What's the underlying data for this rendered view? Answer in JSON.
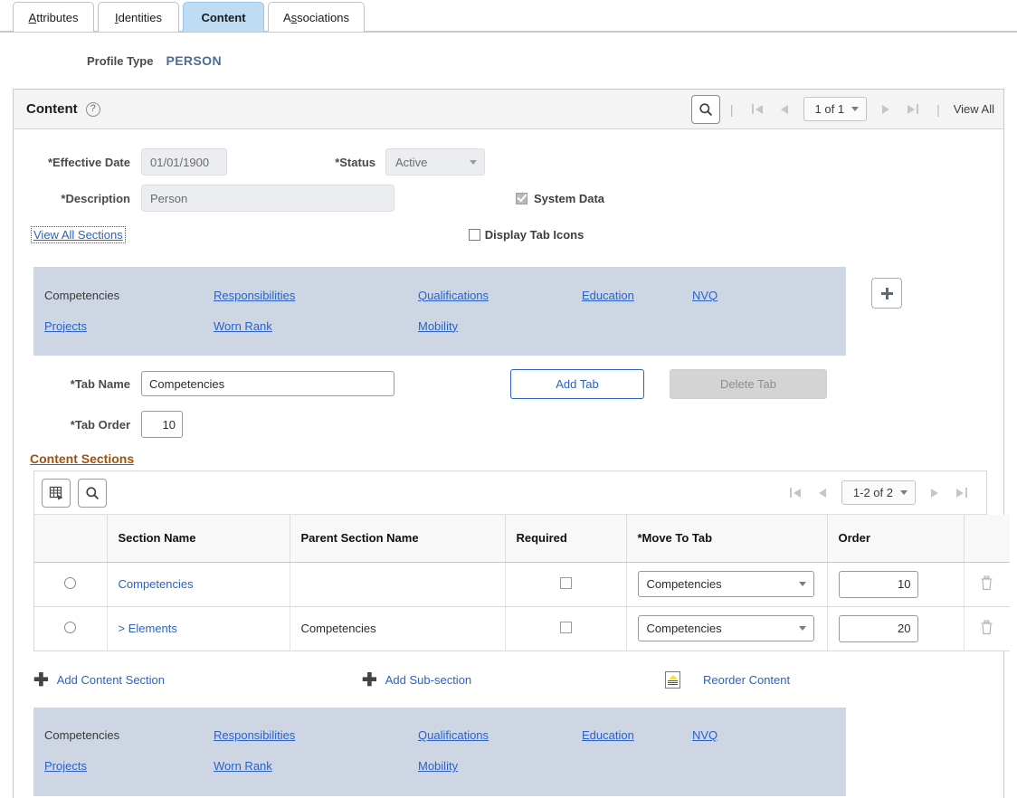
{
  "tabs": [
    {
      "label": "Attributes",
      "accesskey_index": 0,
      "active": false
    },
    {
      "label": "Identities",
      "accesskey_index": 0,
      "active": false
    },
    {
      "label": "Content",
      "accesskey_index": -1,
      "active": true
    },
    {
      "label": "Associations",
      "accesskey_index": 1,
      "active": false
    }
  ],
  "profile": {
    "label": "Profile Type",
    "value": "PERSON"
  },
  "panel": {
    "title": "Content",
    "help_icon": "question-mark-icon",
    "search_icon": "magnifier-icon",
    "pager": {
      "first_icon": "first-page-icon",
      "prev_icon": "previous-page-icon",
      "value": "1 of 1",
      "next_icon": "next-page-icon",
      "last_icon": "last-page-icon"
    },
    "view_all": "View All",
    "add_row_icon": "plus-icon"
  },
  "form": {
    "effective_date_label": "*Effective Date",
    "effective_date_value": "01/01/1900",
    "description_label": "*Description",
    "description_value": "Person",
    "view_all_sections": "View All Sections",
    "status_label": "*Status",
    "status_value": "Active",
    "system_data_label": "System Data",
    "system_data_checked": true,
    "display_tab_icons_label": "Display Tab Icons",
    "display_tab_icons_checked": false
  },
  "tab_links_panel": {
    "row1": [
      {
        "label": "Competencies",
        "is_link": false
      },
      {
        "label": "Responsibilities",
        "is_link": true
      },
      {
        "label": "Qualifications",
        "is_link": true
      },
      {
        "label": "Education",
        "is_link": true
      },
      {
        "label": "NVQ",
        "is_link": true
      }
    ],
    "row2": [
      {
        "label": "Projects",
        "is_link": true
      },
      {
        "label": "Worn Rank",
        "is_link": true
      },
      {
        "label": "Mobility",
        "is_link": true
      }
    ]
  },
  "tab_edit": {
    "tab_name_label": "*Tab Name",
    "tab_name_value": "Competencies",
    "tab_order_label": "*Tab Order",
    "tab_order_value": "10",
    "add_tab": "Add Tab",
    "delete_tab": "Delete Tab"
  },
  "content_sections": {
    "title": "Content Sections",
    "toolbar": {
      "grid_download_icon": "grid-download-icon",
      "find_icon": "magnifier-icon"
    },
    "pager": {
      "first_icon": "first-page-icon",
      "prev_icon": "previous-page-icon",
      "value": "1-2 of 2",
      "next_icon": "next-page-icon",
      "last_icon": "last-page-icon"
    },
    "columns": [
      "",
      "Section Name",
      "Parent Section Name",
      "Required",
      "*Move To Tab",
      "Order",
      ""
    ],
    "rows": [
      {
        "select": "radio",
        "section_name": "Competencies",
        "parent_section_name": "",
        "required": false,
        "move_to_tab": "Competencies",
        "order": "10",
        "delete_icon": "trash-icon"
      },
      {
        "select": "radio",
        "section_name": "> Elements",
        "parent_section_name": "Competencies",
        "required": false,
        "move_to_tab": "Competencies",
        "order": "20",
        "delete_icon": "trash-icon"
      }
    ]
  },
  "bottom_actions": [
    {
      "label": "Add Content Section",
      "icon": "plus-icon"
    },
    {
      "label": "Add Sub-section",
      "icon": "plus-icon"
    },
    {
      "label": "Reorder Content",
      "icon": "reorder-icon"
    }
  ],
  "colors": {
    "active_tab": "#bfdcf5",
    "link": "#2a62c6",
    "tab_panel_bg": "#ced6e4",
    "section_heading": "#a1520a",
    "profile_value": "#4a6b9e"
  }
}
